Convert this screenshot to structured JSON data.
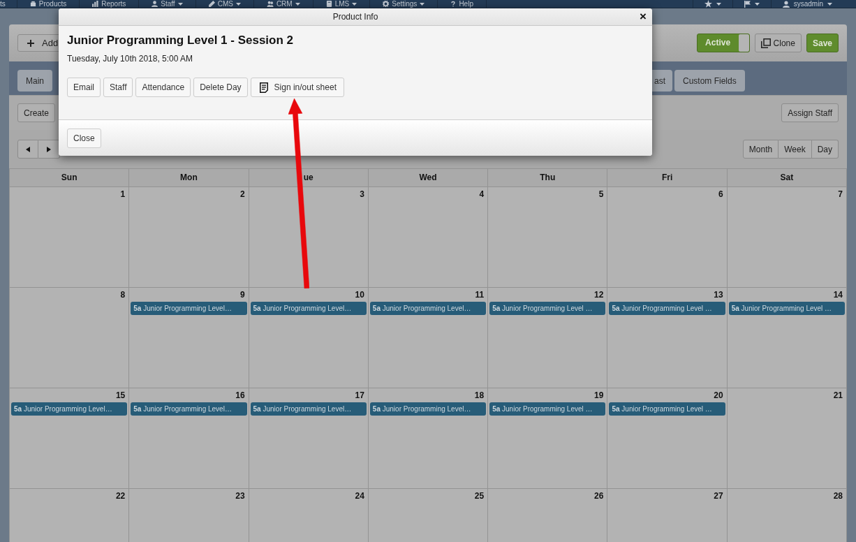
{
  "nav": {
    "items": [
      {
        "label": "ts",
        "dropdown": false
      },
      {
        "label": "Products",
        "dropdown": false
      },
      {
        "label": "Reports",
        "dropdown": false
      },
      {
        "label": "Staff",
        "dropdown": true
      },
      {
        "label": "CMS",
        "dropdown": true
      },
      {
        "label": "CRM",
        "dropdown": true
      },
      {
        "label": "LMS",
        "dropdown": true
      },
      {
        "label": "Settings",
        "dropdown": true
      },
      {
        "label": "Help",
        "dropdown": false
      }
    ],
    "right_items": [
      {
        "dropdown": true
      },
      {
        "dropdown": true
      },
      {
        "label": "sysadmin",
        "dropdown": true
      }
    ]
  },
  "header": {
    "add_button": "Add",
    "status_toggle": {
      "label": "Active",
      "on": true
    },
    "clone_button": "Clone",
    "save_button": "Save"
  },
  "tabs_left": [
    {
      "label": "Main",
      "selected": false
    }
  ],
  "tabs_right": [
    {
      "label": "ast",
      "selected": false
    },
    {
      "label": "Custom Fields",
      "selected": false
    }
  ],
  "actions": {
    "create_button": "Create",
    "assign_staff_button": "Assign Staff"
  },
  "views": [
    {
      "label": "Month",
      "selected": false
    },
    {
      "label": "Week",
      "selected": false
    },
    {
      "label": "Day",
      "selected": false
    }
  ],
  "calendar": {
    "weekdays": [
      "Sun",
      "Mon",
      "ue",
      "Wed",
      "Thu",
      "Fri",
      "Sat"
    ],
    "weeks": [
      [
        {
          "day": "1"
        },
        {
          "day": "2"
        },
        {
          "day": "3"
        },
        {
          "day": "4"
        },
        {
          "day": "5"
        },
        {
          "day": "6"
        },
        {
          "day": "7"
        }
      ],
      [
        {
          "day": "8"
        },
        {
          "day": "9",
          "events": [
            {
              "time": "5a",
              "title": "Junior Programming Level…"
            }
          ]
        },
        {
          "day": "10",
          "events": [
            {
              "time": "5a",
              "title": "Junior Programming Level…"
            }
          ]
        },
        {
          "day": "11",
          "events": [
            {
              "time": "5a",
              "title": "Junior Programming Level…"
            }
          ]
        },
        {
          "day": "12",
          "events": [
            {
              "time": "5a",
              "title": "Junior Programming Level …"
            }
          ]
        },
        {
          "day": "13",
          "events": [
            {
              "time": "5a",
              "title": "Junior Programming Level …"
            }
          ]
        },
        {
          "day": "14",
          "events": [
            {
              "time": "5a",
              "title": "Junior Programming Level …"
            }
          ]
        }
      ],
      [
        {
          "day": "15",
          "events": [
            {
              "time": "5a",
              "title": "Junior Programming Level…"
            }
          ]
        },
        {
          "day": "16",
          "events": [
            {
              "time": "5a",
              "title": "Junior Programming Level…"
            }
          ]
        },
        {
          "day": "17",
          "events": [
            {
              "time": "5a",
              "title": "Junior Programming Level…"
            }
          ]
        },
        {
          "day": "18",
          "events": [
            {
              "time": "5a",
              "title": "Junior Programming Level…"
            }
          ]
        },
        {
          "day": "19",
          "events": [
            {
              "time": "5a",
              "title": "Junior Programming Level …"
            }
          ]
        },
        {
          "day": "20",
          "events": [
            {
              "time": "5a",
              "title": "Junior Programming Level …"
            }
          ]
        },
        {
          "day": "21"
        }
      ],
      [
        {
          "day": "22"
        },
        {
          "day": "23"
        },
        {
          "day": "24"
        },
        {
          "day": "25"
        },
        {
          "day": "26"
        },
        {
          "day": "27"
        },
        {
          "day": "28"
        }
      ]
    ]
  },
  "modal": {
    "title": "Product Info",
    "close_symbol": "×",
    "heading": "Junior Programming Level 1 - Session 2",
    "date": "Tuesday, July 10th 2018, 5:00 AM",
    "buttons": [
      {
        "label": "Email",
        "kind": "plain"
      },
      {
        "label": "Staff",
        "kind": "plain"
      },
      {
        "label": "Attendance",
        "kind": "plain"
      },
      {
        "label": "Delete Day",
        "kind": "plain"
      },
      {
        "label": "Sign in/out sheet",
        "kind": "with_icon"
      }
    ],
    "footer_button": "Close"
  },
  "annotation": {
    "arrow": true
  }
}
